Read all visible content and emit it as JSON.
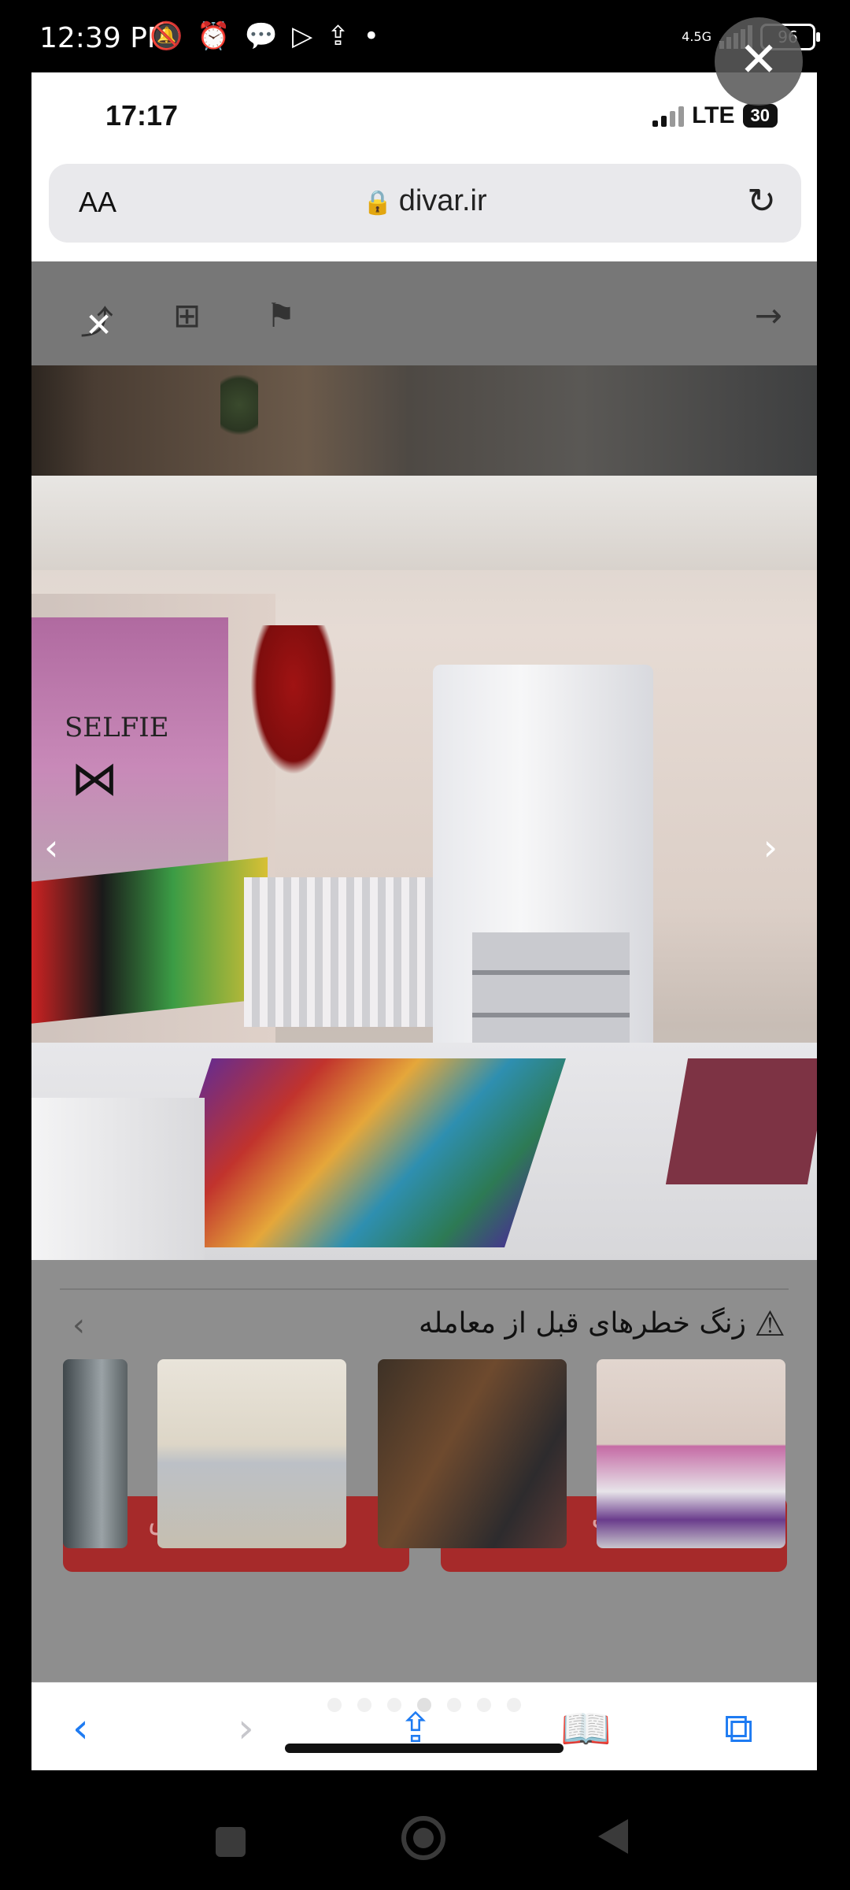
{
  "android_status": {
    "time": "12:39 PM",
    "icons": [
      "mute-icon",
      "alarm-icon",
      "chat-icon",
      "play-icon",
      "upload-icon",
      "dot-icon"
    ],
    "net_speed": "4.5G",
    "battery": "96"
  },
  "ios_status": {
    "time": "17:17",
    "network": "LTE",
    "battery": "30"
  },
  "browser": {
    "text_size_label": "AA",
    "url": "divar.ir",
    "reload_icon": "reload-icon"
  },
  "ad_toolbar": {
    "icons": [
      "share-icon",
      "add-note-icon",
      "bookmark-icon",
      "arrow-forward-icon"
    ]
  },
  "gallery": {
    "poster_text": "SELFIE",
    "prev_arrow": "‹",
    "next_arrow": "›"
  },
  "safety": {
    "title": "زنگ خطرهای قبل از معامله",
    "warning_icon": "warning-icon"
  },
  "buttons": {
    "contact": "اطلاعات تماس",
    "chat": "چت"
  },
  "safari_bar": {
    "icons": [
      "back-icon",
      "forward-icon",
      "share-icon",
      "bookmarks-icon",
      "tabs-icon"
    ]
  },
  "colors": {
    "accent": "#1e7bf2",
    "brand_red": "#a62a2a"
  }
}
